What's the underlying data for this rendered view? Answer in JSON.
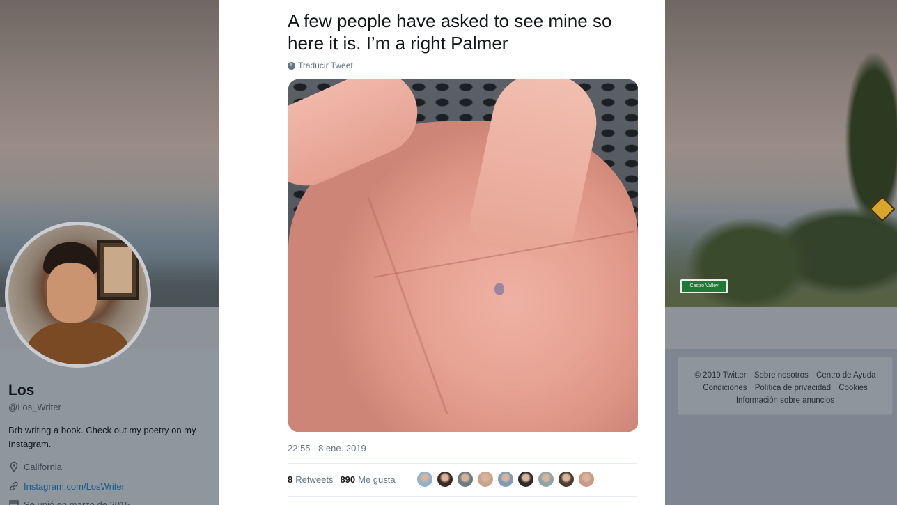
{
  "tweet": {
    "text": "A few people have asked to see mine so here it is. I’m a right Palmer",
    "translate_label": "Traducir Tweet",
    "timestamp": "22:55 - 8 ene. 2019",
    "retweets_count": "8",
    "retweets_label": "Retweets",
    "likes_count": "890",
    "likes_label": "Me gusta",
    "likers": [
      {
        "color": "#8fb2cf"
      },
      {
        "color": "#3b2a24"
      },
      {
        "color": "#6d7a80"
      },
      {
        "color": "#c7a58c"
      },
      {
        "color": "#7f9bb8"
      },
      {
        "color": "#2e2a28"
      },
      {
        "color": "#90a4a8"
      },
      {
        "color": "#4b3d2f"
      },
      {
        "color": "#c99a86"
      }
    ]
  },
  "profile": {
    "name": "Los",
    "handle": "@Los_Writer",
    "bio": "Brb writing a book. Check out my poetry on my Instagram.",
    "location": "California",
    "link": "Instagram.com/LosWriter",
    "joined": "Se unió en marzo de 2015"
  },
  "banner": {
    "road_sign_text": "Castro Valley"
  },
  "footer": {
    "row1": [
      "© 2019 Twitter",
      "Sobre nosotros",
      "Centro de Ayuda"
    ],
    "row2": [
      "Condiciones",
      "Política de privacidad",
      "Cookies"
    ],
    "row3": [
      "Información sobre anuncios"
    ]
  },
  "icons": {
    "location": "location-pin-icon",
    "link": "link-icon",
    "calendar": "calendar-icon",
    "globe": "globe-icon"
  }
}
